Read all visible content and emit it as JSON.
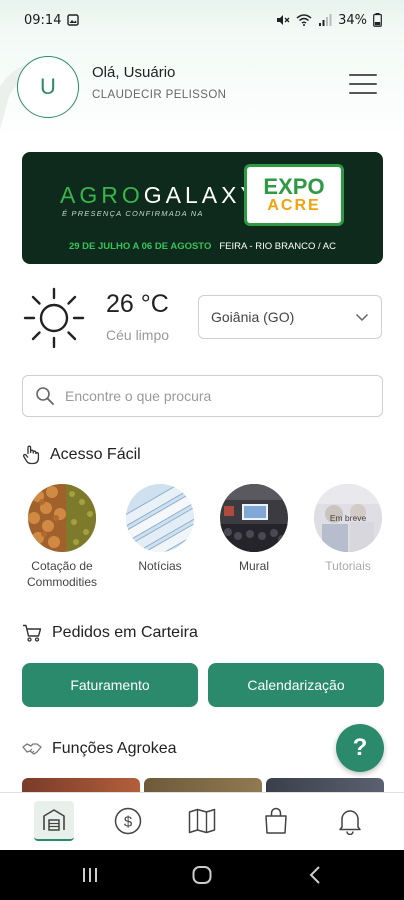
{
  "status_bar": {
    "time": "09:14",
    "battery": "34%"
  },
  "header": {
    "avatar_letter": "U",
    "greeting": "Olá, Usuário",
    "username": "CLAUDECIR PELISSON"
  },
  "banner": {
    "brand_part1": "AGRO",
    "brand_part2": "GALAXY",
    "subtitle": "É PRESENÇA CONFIRMADA NA",
    "expo_word": "EXPO",
    "expo_sub": "ACRE",
    "date_text": "29 DE JULHO A 06 DE AGOSTO",
    "place_text": "FEIRA - RIO BRANCO / AC"
  },
  "weather": {
    "temperature": "26 °C",
    "condition": "Céu limpo",
    "city": "Goiânia (GO)"
  },
  "search": {
    "placeholder": "Encontre o que procura"
  },
  "quick_access": {
    "title": "Acesso Fácil",
    "items": [
      {
        "label": "Cotação de Commodities"
      },
      {
        "label": "Notícias"
      },
      {
        "label": "Mural"
      },
      {
        "label": "Tutoriais",
        "badge": "Em breve"
      }
    ]
  },
  "orders": {
    "title": "Pedidos em Carteira",
    "btn_billing": "Faturamento",
    "btn_schedule": "Calendarização"
  },
  "functions": {
    "title": "Funções Agrokea"
  },
  "help_fab": "?",
  "colors": {
    "primary": "#2a8a6b",
    "banner_bg": "#0d2a1c",
    "banner_green": "#39b54a"
  }
}
